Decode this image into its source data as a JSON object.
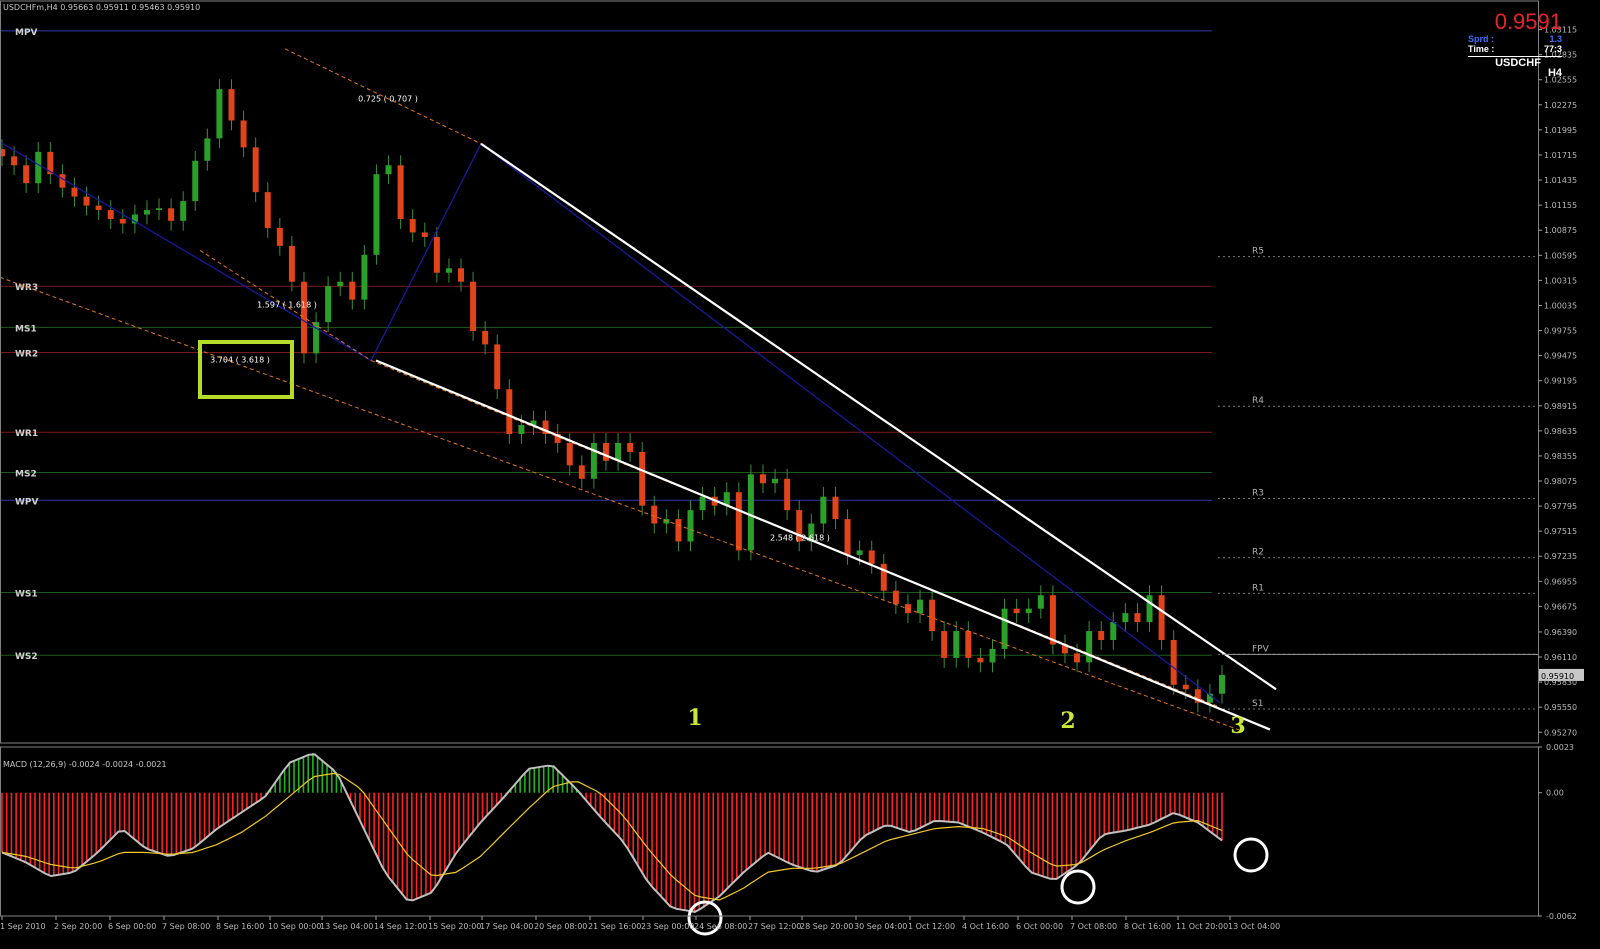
{
  "header": {
    "symbol_info": "USDCHFm,H4  0.95663 0.95911 0.95463 0.95910",
    "macd_info": "MACD (12,26,9) -0.0024 -0.0024 -0.0021"
  },
  "info_panel": {
    "bid": "0.9591",
    "spread_label": "Sprd :",
    "spread_value": "1.3",
    "time_label": "Time :",
    "time_value": "77:3",
    "symbol": "USDCHF",
    "timeframe": "H4"
  },
  "current_price_label": "0.95910",
  "colors": {
    "background": "#000000",
    "bull_candle": "#2aa02a",
    "bear_candle": "#e1431b",
    "trendline": "#ffffff",
    "fib_line": "#e0751f",
    "blue_line": "#1a1aa8",
    "annotation_box": "#b4dc28",
    "label_numbers": "#c8e63c",
    "macd_hist": "#ff2020",
    "macd_hist_pos": "#23b423",
    "macd_main": "#c0c0c0",
    "macd_signal": "#f0c828"
  },
  "chart_data": [
    {
      "type": "candlestick",
      "title": "USDCHFm,H4",
      "x": [
        "1 Sep 2010",
        "2 Sep 20:00",
        "6 Sep 00:00",
        "7 Sep 08:00",
        "8 Sep 16:00",
        "10 Sep 00:00",
        "13 Sep 04:00",
        "14 Sep 12:00",
        "15 Sep 20:00",
        "17 Sep 04:00",
        "20 Sep 08:00",
        "21 Sep 16:00",
        "23 Sep 00:00",
        "24 Sep 08:00",
        "27 Sep 12:00",
        "28 Sep 20:00",
        "30 Sep 04:00",
        "1 Oct 12:00",
        "4 Oct 16:00",
        "6 Oct 00:00",
        "7 Oct 08:00",
        "8 Oct 16:00",
        "11 Oct 20:00",
        "13 Oct 04:00"
      ],
      "ylim": [
        0.9515,
        1.033
      ],
      "y_ticks": [
        "1.03115",
        "1.02835",
        "1.02555",
        "1.02275",
        "1.01995",
        "1.01715",
        "1.01435",
        "1.01155",
        "1.00875",
        "1.00595",
        "1.00315",
        "1.00035",
        "0.99755",
        "0.99475",
        "0.99195",
        "0.98915",
        "0.98635",
        "0.98355",
        "0.98075",
        "0.97795",
        "0.97515",
        "0.97235",
        "0.96955",
        "0.96675",
        "0.96390",
        "0.96110",
        "0.95830",
        "0.95550",
        "0.95270"
      ],
      "close_series": [
        1.017,
        1.016,
        1.014,
        1.0175,
        1.015,
        1.0135,
        1.0125,
        1.0115,
        1.011,
        1.01,
        1.0095,
        1.0105,
        1.011,
        1.0112,
        1.0098,
        1.012,
        1.0165,
        1.019,
        1.0245,
        1.021,
        1.018,
        1.013,
        1.009,
        1.007,
        1.003,
        0.995,
        0.9985,
        1.0025,
        1.003,
        1.001,
        1.006,
        1.015,
        1.016,
        1.01,
        1.0085,
        1.008,
        1.004,
        1.0045,
        1.003,
        0.9975,
        0.996,
        0.991,
        0.986,
        0.987,
        0.9875,
        0.986,
        0.985,
        0.9825,
        0.981,
        0.985,
        0.983,
        0.985,
        0.984,
        0.978,
        0.976,
        0.9765,
        0.974,
        0.9775,
        0.979,
        0.978,
        0.9795,
        0.973,
        0.9815,
        0.9805,
        0.981,
        0.9775,
        0.974,
        0.976,
        0.979,
        0.9765,
        0.9725,
        0.973,
        0.9715,
        0.9685,
        0.967,
        0.966,
        0.9675,
        0.964,
        0.961,
        0.964,
        0.961,
        0.9605,
        0.962,
        0.9665,
        0.966,
        0.9665,
        0.968,
        0.9625,
        0.9615,
        0.9605,
        0.964,
        0.963,
        0.965,
        0.966,
        0.965,
        0.968,
        0.963,
        0.958,
        0.9575,
        0.956,
        0.957,
        0.9591
      ],
      "horizontal_levels": [
        {
          "label": "MPV",
          "value": 1.031,
          "color": "#2d3aa8"
        },
        {
          "label": "WR3",
          "value": 1.0025,
          "color": "#7a1a1a"
        },
        {
          "label": "MS1",
          "value": 0.9979,
          "color": "#1c5a1c"
        },
        {
          "label": "WR2",
          "value": 0.9951,
          "color": "#7a1a1a"
        },
        {
          "label": "WR1",
          "value": 0.9862,
          "color": "#7a1a1a"
        },
        {
          "label": "MS2",
          "value": 0.9817,
          "color": "#1c5a1c"
        },
        {
          "label": "WPV",
          "value": 0.9786,
          "color": "#2d3aa8"
        },
        {
          "label": "WS1",
          "value": 0.9683,
          "color": "#1c5a1c"
        },
        {
          "label": "WS2",
          "value": 0.9613,
          "color": "#1c5a1c"
        }
      ],
      "right_levels": [
        {
          "label": "R5",
          "value": 1.0058
        },
        {
          "label": "R4",
          "value": 0.9891
        },
        {
          "label": "R3",
          "value": 0.9788
        },
        {
          "label": "R2",
          "value": 0.9722
        },
        {
          "label": "R1",
          "value": 0.9682
        },
        {
          "label": "FPV",
          "value": 0.9614
        },
        {
          "label": "S1",
          "value": 0.9553
        }
      ],
      "fib_labels": [
        "0.725 ( 0.707 )",
        "1.597 ( 1.618 )",
        "3.704 ( 3.618 )",
        "2.548 ( 2.618 )"
      ],
      "wave_labels": [
        "1",
        "2",
        "3"
      ]
    },
    {
      "type": "bar",
      "title": "MACD (12,26,9)",
      "ylim": [
        -0.0062,
        0.0023
      ],
      "y_ticks": [
        "0.0023",
        "0.00",
        "-0.0062"
      ],
      "main_values": [
        -0.003,
        -0.0035,
        -0.0042,
        -0.004,
        -0.003,
        -0.0018,
        -0.0028,
        -0.0032,
        -0.0028,
        -0.0018,
        -0.001,
        -0.0002,
        0.0015,
        0.002,
        0.001,
        -0.0015,
        -0.004,
        -0.0055,
        -0.005,
        -0.003,
        -0.0015,
        -0.0002,
        0.0012,
        0.0014,
        0.0002,
        -0.0012,
        -0.0025,
        -0.0045,
        -0.0058,
        -0.006,
        -0.0052,
        -0.004,
        -0.003,
        -0.0036,
        -0.004,
        -0.0036,
        -0.0022,
        -0.0016,
        -0.002,
        -0.0014,
        -0.0015,
        -0.002,
        -0.0026,
        -0.004,
        -0.0044,
        -0.0036,
        -0.0021,
        -0.0019,
        -0.0016,
        -0.001,
        -0.0015,
        -0.0024
      ],
      "signal_values": [
        -0.003,
        -0.0032,
        -0.0036,
        -0.0038,
        -0.0035,
        -0.003,
        -0.003,
        -0.0031,
        -0.003,
        -0.0026,
        -0.002,
        -0.0012,
        -0.0002,
        0.0008,
        0.001,
        0.0002,
        -0.0015,
        -0.0032,
        -0.0042,
        -0.004,
        -0.0032,
        -0.002,
        -0.0008,
        0.0003,
        0.0006,
        0.0,
        -0.0012,
        -0.0028,
        -0.0042,
        -0.0052,
        -0.0054,
        -0.0048,
        -0.004,
        -0.0038,
        -0.0038,
        -0.0036,
        -0.003,
        -0.0024,
        -0.0021,
        -0.0018,
        -0.0017,
        -0.0018,
        -0.0022,
        -0.003,
        -0.0037,
        -0.0036,
        -0.0029,
        -0.0024,
        -0.002,
        -0.0015,
        -0.0014,
        -0.0019
      ]
    }
  ]
}
